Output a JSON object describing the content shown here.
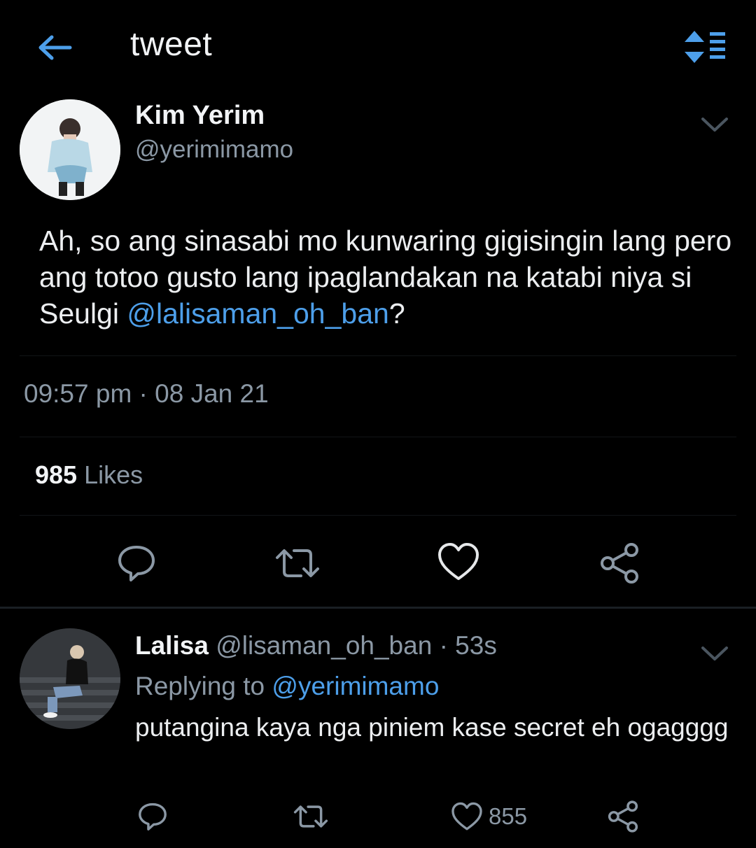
{
  "header": {
    "title": "tweet"
  },
  "tweet": {
    "author_name": "Kim Yerim",
    "author_handle": "@yerimimamo",
    "text_before": "Ah, so ang sinasabi mo kunwaring gigisingin lang pero ang totoo gusto lang ipaglandakan na katabi niya si Seulgi ",
    "mention": "@lalisaman_oh_ban",
    "text_after": "?",
    "timestamp": "09:57 pm · 08 Jan 21",
    "likes_count": "985",
    "likes_label": "Likes"
  },
  "reply": {
    "author_name": "Lalisa",
    "author_handle": "@lisaman_oh_ban",
    "time": "· 53s",
    "replying_prefix": "Replying to ",
    "replying_to": "@yerimimamo",
    "text": "putangina kaya nga piniem kase secret eh ogagggg",
    "like_count": "855"
  },
  "colors": {
    "background": "#000000",
    "accent": "#4d9fea",
    "muted": "#8b98a5",
    "text": "#eceef0"
  },
  "icons": [
    "back-arrow-icon",
    "sort-icon",
    "chevron-down-icon",
    "reply-icon",
    "retweet-icon",
    "heart-icon",
    "share-icon"
  ]
}
